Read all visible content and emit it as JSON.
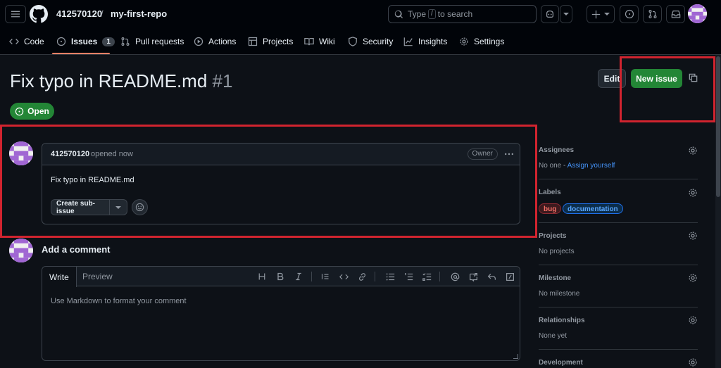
{
  "header": {
    "owner": "412570120",
    "separator": "/",
    "repo": "my-first-repo",
    "search_prefix": "Type",
    "search_key": "/",
    "search_suffix": "to search"
  },
  "nav": {
    "tabs": [
      {
        "label": "Code"
      },
      {
        "label": "Issues",
        "count": "1"
      },
      {
        "label": "Pull requests"
      },
      {
        "label": "Actions"
      },
      {
        "label": "Projects"
      },
      {
        "label": "Wiki"
      },
      {
        "label": "Security"
      },
      {
        "label": "Insights"
      },
      {
        "label": "Settings"
      }
    ]
  },
  "issue": {
    "title": "Fix typo in README.md",
    "number": "#1",
    "state": "Open",
    "edit_label": "Edit",
    "new_issue_label": "New issue"
  },
  "comment": {
    "author": "412570120",
    "action": "opened now",
    "role": "Owner",
    "body": "Fix typo in README.md",
    "sub_issue_label": "Create sub-issue"
  },
  "add_comment": {
    "heading": "Add a comment",
    "write_tab": "Write",
    "preview_tab": "Preview",
    "placeholder": "Use Markdown to format your comment"
  },
  "sidebar": {
    "assignees": {
      "heading": "Assignees",
      "value": "No one - ",
      "link": "Assign yourself"
    },
    "labels": {
      "heading": "Labels",
      "items": [
        {
          "name": "bug",
          "color": "#d73a4a"
        },
        {
          "name": "documentation",
          "color": "#0075ca"
        }
      ]
    },
    "projects": {
      "heading": "Projects",
      "value": "No projects"
    },
    "milestone": {
      "heading": "Milestone",
      "value": "No milestone"
    },
    "relationships": {
      "heading": "Relationships",
      "value": "None yet"
    },
    "development": {
      "heading": "Development"
    }
  },
  "colors": {
    "accent_green": "#238636",
    "highlight_red": "#d1242f",
    "link_blue": "#4493f8"
  }
}
